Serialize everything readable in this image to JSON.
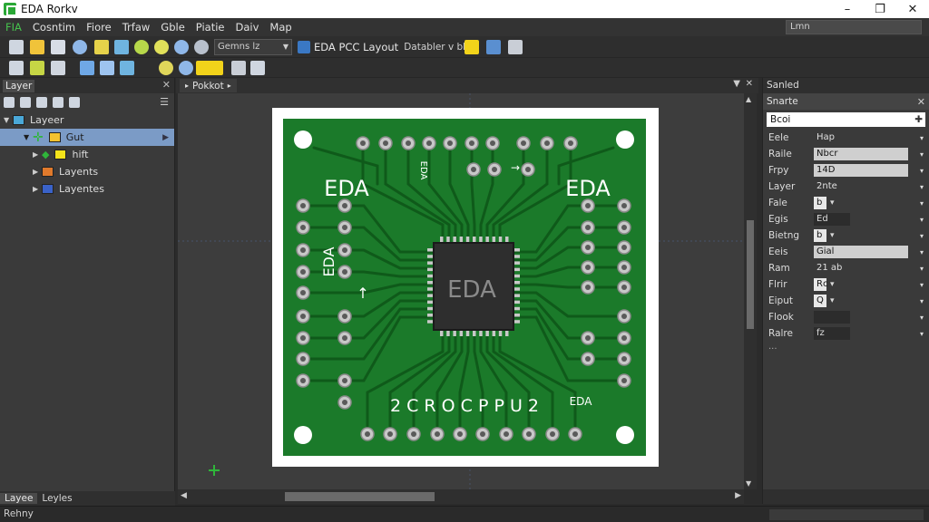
{
  "window": {
    "title": "EDA Rorkv",
    "min": "–",
    "max": "❐",
    "close": "✕"
  },
  "menu": {
    "items": [
      "FIA",
      "Cosntim",
      "Fiore",
      "Trfaw",
      "Gble",
      "Piatie",
      "Daiv",
      "Map"
    ],
    "search": "Lmn"
  },
  "toolbar": {
    "combo": "Gemns lz",
    "doc_title": "EDA PCC Layout",
    "doc_sub": "Databler v bh"
  },
  "layers": {
    "header": "Layer",
    "root": "Layeer",
    "items": [
      {
        "label": "Gut",
        "color": "#f2c230"
      },
      {
        "label": "hift",
        "color": "#f4e31a"
      },
      {
        "label": "Layents",
        "color": "#e07a2c"
      },
      {
        "label": "Layentes",
        "color": "#3a62c8"
      }
    ],
    "tabs": [
      "Layee",
      "Leyles"
    ]
  },
  "document": {
    "tab": "Pokkot"
  },
  "board": {
    "chip_label": "EDA",
    "silk_left": "EDA",
    "silk_right": "EDA",
    "silk_bottom": "2 C R O C P P U 2",
    "silk_bottom_right": "EDA",
    "silk_vert_left": "EDA",
    "silk_vert_right": "EDA",
    "silk_top_small": "EDA"
  },
  "properties": {
    "panel": "Sanled",
    "title": "Snarte",
    "search": "Bcoi",
    "rows": [
      {
        "label": "Eele",
        "value": "Hap",
        "style": "text"
      },
      {
        "label": "Raile",
        "value": "Nbcr",
        "style": "box"
      },
      {
        "label": "Frpy",
        "value": "14D",
        "style": "box"
      },
      {
        "label": "Layer",
        "value": "2nte",
        "style": "text"
      },
      {
        "label": "Fale",
        "value": "b",
        "style": "mini"
      },
      {
        "label": "Egis",
        "value": "Ed",
        "style": "dark"
      },
      {
        "label": "Bietng",
        "value": "b",
        "style": "mini"
      },
      {
        "label": "Eeis",
        "value": "Gial",
        "style": "box"
      },
      {
        "label": "Ram",
        "value": "21 ab",
        "style": "text"
      },
      {
        "label": "Flrir",
        "value": "Rc",
        "style": "mini"
      },
      {
        "label": "Eiput",
        "value": "Q",
        "style": "mini"
      },
      {
        "label": "Flook",
        "value": "",
        "style": "dark"
      },
      {
        "label": "Ralre",
        "value": "fz",
        "style": "dark"
      }
    ],
    "more": "..."
  },
  "status": {
    "text": "Rehny"
  },
  "colors": {
    "pcb_green": "#1b7a2a",
    "board_frame": "#ffffff",
    "accent_yellow": "#f2d31a",
    "selection": "#7b9bc6"
  }
}
